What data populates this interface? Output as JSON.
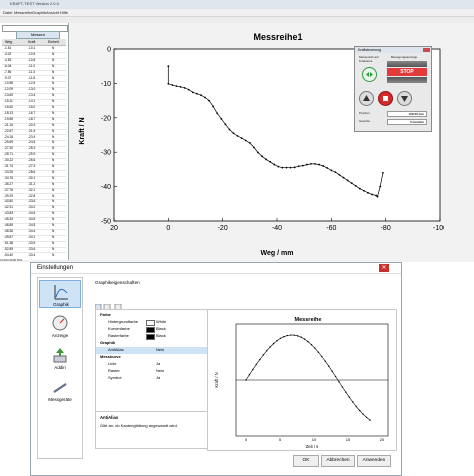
{
  "app": {
    "title": "KRAFT-TEST  Version 2.0.0",
    "menu": [
      "Datei",
      "Messreihe",
      "Graphik",
      "Ansicht",
      "Hilfe"
    ],
    "left": {
      "tab_label": "Messen",
      "columns": [
        "Weg",
        "Kraft",
        "Einheit"
      ],
      "rows": [
        [
          "-1.51",
          "-10.1",
          "N"
        ],
        [
          "-3.02",
          "-10.5",
          "N"
        ],
        [
          "-4.53",
          "-10.8",
          "N"
        ],
        [
          "-6.04",
          "-11.0",
          "N"
        ],
        [
          "-7.56",
          "-11.3",
          "N"
        ],
        [
          "-9.07",
          "-11.8",
          "N"
        ],
        [
          "-10.58",
          "-12.6",
          "N"
        ],
        [
          "-12.09",
          "-13.0",
          "N"
        ],
        [
          "-13.60",
          "-13.4",
          "N"
        ],
        [
          "-15.11",
          "-14.1",
          "N"
        ],
        [
          "-16.62",
          "-15.0",
          "N"
        ],
        [
          "-18.13",
          "-16.7",
          "N"
        ],
        [
          "-19.65",
          "-18.7",
          "N"
        ],
        [
          "-21.16",
          "-20.3",
          "N"
        ],
        [
          "-22.67",
          "-21.9",
          "N"
        ],
        [
          "-24.18",
          "-23.4",
          "N"
        ],
        [
          "-25.69",
          "-24.5",
          "N"
        ],
        [
          "-27.20",
          "-25.3",
          "N"
        ],
        [
          "-28.71",
          "-25.9",
          "N"
        ],
        [
          "-30.22",
          "-26.6",
          "N"
        ],
        [
          "-31.74",
          "-27.3",
          "N"
        ],
        [
          "-33.25",
          "-28.6",
          "N"
        ],
        [
          "-34.76",
          "-30.1",
          "N"
        ],
        [
          "-36.27",
          "-31.2",
          "N"
        ],
        [
          "-37.78",
          "-32.1",
          "N"
        ],
        [
          "-39.29",
          "-32.8",
          "N"
        ],
        [
          "-40.80",
          "-33.6",
          "N"
        ],
        [
          "-42.31",
          "-34.2",
          "N"
        ],
        [
          "-43.83",
          "-34.5",
          "N"
        ],
        [
          "-45.34",
          "-34.5",
          "N"
        ],
        [
          "-46.85",
          "-34.5",
          "N"
        ],
        [
          "-48.36",
          "-34.4",
          "N"
        ],
        [
          "-49.87",
          "-34.1",
          "N"
        ],
        [
          "-51.38",
          "-33.9",
          "N"
        ],
        [
          "-52.89",
          "-33.6",
          "N"
        ],
        [
          "-54.40",
          "-33.4",
          "N"
        ]
      ]
    },
    "status": "COM3 9600 8N1"
  },
  "chart_data": {
    "type": "line",
    "title": "Messreihe1",
    "xlabel": "Weg / mm",
    "ylabel": "Kraft / N",
    "xlim": [
      20,
      -100
    ],
    "ylim": [
      -50,
      0
    ],
    "xticks": [
      "20",
      "0",
      "-20",
      "-40",
      "-60",
      "-80",
      "-100"
    ],
    "yticks": [
      "0",
      "-10",
      "-20",
      "-30",
      "-40",
      "-50"
    ],
    "grid": false,
    "series": [
      {
        "x": [
          0,
          0,
          -1.5,
          -3,
          -4.5,
          -6,
          -7.5,
          -9,
          -10.5,
          -12,
          -13.5,
          -15,
          -16.5,
          -18,
          -19.5,
          -21,
          -22.5,
          -24,
          -25.5,
          -27,
          -28.5,
          -30,
          -31.5,
          -33,
          -34.5,
          -36,
          -37.5,
          -39,
          -40.5,
          -42,
          -43.5,
          -45,
          -46.5,
          -48,
          -49.5,
          -51,
          -52.5,
          -54,
          -55.5,
          -57,
          -58.5,
          -60,
          -61.5,
          -63,
          -64.5,
          -66,
          -67.5,
          -69,
          -70.5,
          -72,
          -73.5,
          -75,
          -76.5,
          -77,
          -78,
          -79
        ],
        "y": [
          -5,
          -10.1,
          -10.5,
          -10.8,
          -11,
          -11.3,
          -11.8,
          -12.6,
          -13,
          -13.4,
          -14.1,
          -15,
          -16.7,
          -18.7,
          -20.3,
          -21.9,
          -23.4,
          -24.5,
          -25.3,
          -25.9,
          -26.6,
          -27.3,
          -28.6,
          -30.1,
          -31.2,
          -32.1,
          -32.8,
          -33.6,
          -34.2,
          -34.5,
          -34.5,
          -34.5,
          -34.4,
          -34.1,
          -33.9,
          -33.6,
          -33.4,
          -33.4,
          -33.6,
          -34,
          -34.6,
          -35.3,
          -35.8,
          -36.6,
          -37.4,
          -38.2,
          -39,
          -39.8,
          -40.6,
          -41.2,
          -41.8,
          -42.3,
          -42.6,
          -42.9,
          -40,
          -36
        ]
      }
    ]
  },
  "control": {
    "title": "Kraftsteuerung",
    "lbl_pos_mode": "Messpunkt auf Kraftstoss",
    "lbl_move": "Bewegungsanzeige",
    "stop": "STOP",
    "position_label": "Position",
    "position_value": "108.50 mm",
    "speed_label": "Geschw.",
    "speed_value": "0 mm/min",
    "colors": {
      "green": "#2f9a3d",
      "red": "#d42a2a"
    }
  },
  "dialog": {
    "title": "Einstellungen",
    "close": "✕",
    "nav": [
      {
        "label": "Graphik",
        "icon": "graph-icon"
      },
      {
        "label": "Anzeige",
        "icon": "gauge-icon"
      },
      {
        "label": "Addin",
        "icon": "addin-icon"
      },
      {
        "label": "Messgeräte",
        "icon": "device-icon"
      }
    ],
    "panel_title": "Graphikeigenschaften",
    "props": {
      "group_farbe": "Farbe",
      "bg_key": "Hintergrundfarbe",
      "bg_val": "White",
      "curve_key": "Kurvenfarbe",
      "curve_val": "Black",
      "grid_key": "Rasterfarbe",
      "grid_val": "Black",
      "group_graphik": "Graphik",
      "aa_key": "AntiAlias",
      "aa_val": "Nein",
      "group_kurve": "Messkurve",
      "line_key": "Linie",
      "line_val": "Ja",
      "raster_key": "Raster",
      "raster_val": "Nein",
      "symbol_key": "Symbol",
      "symbol_val": "Ja"
    },
    "desc_title": "AntiAlias",
    "desc_text": "Gibt an, ob Kantenglättung angewandt wird.",
    "preview": {
      "title": "Messreihe",
      "xlabel": "Zeit / s",
      "ylabel": "Kraft / N",
      "xticks": [
        "0",
        "5",
        "10",
        "15",
        "20"
      ]
    },
    "btn_ok": "OK",
    "btn_cancel": "Abbrechen",
    "btn_apply": "Anwenden"
  }
}
